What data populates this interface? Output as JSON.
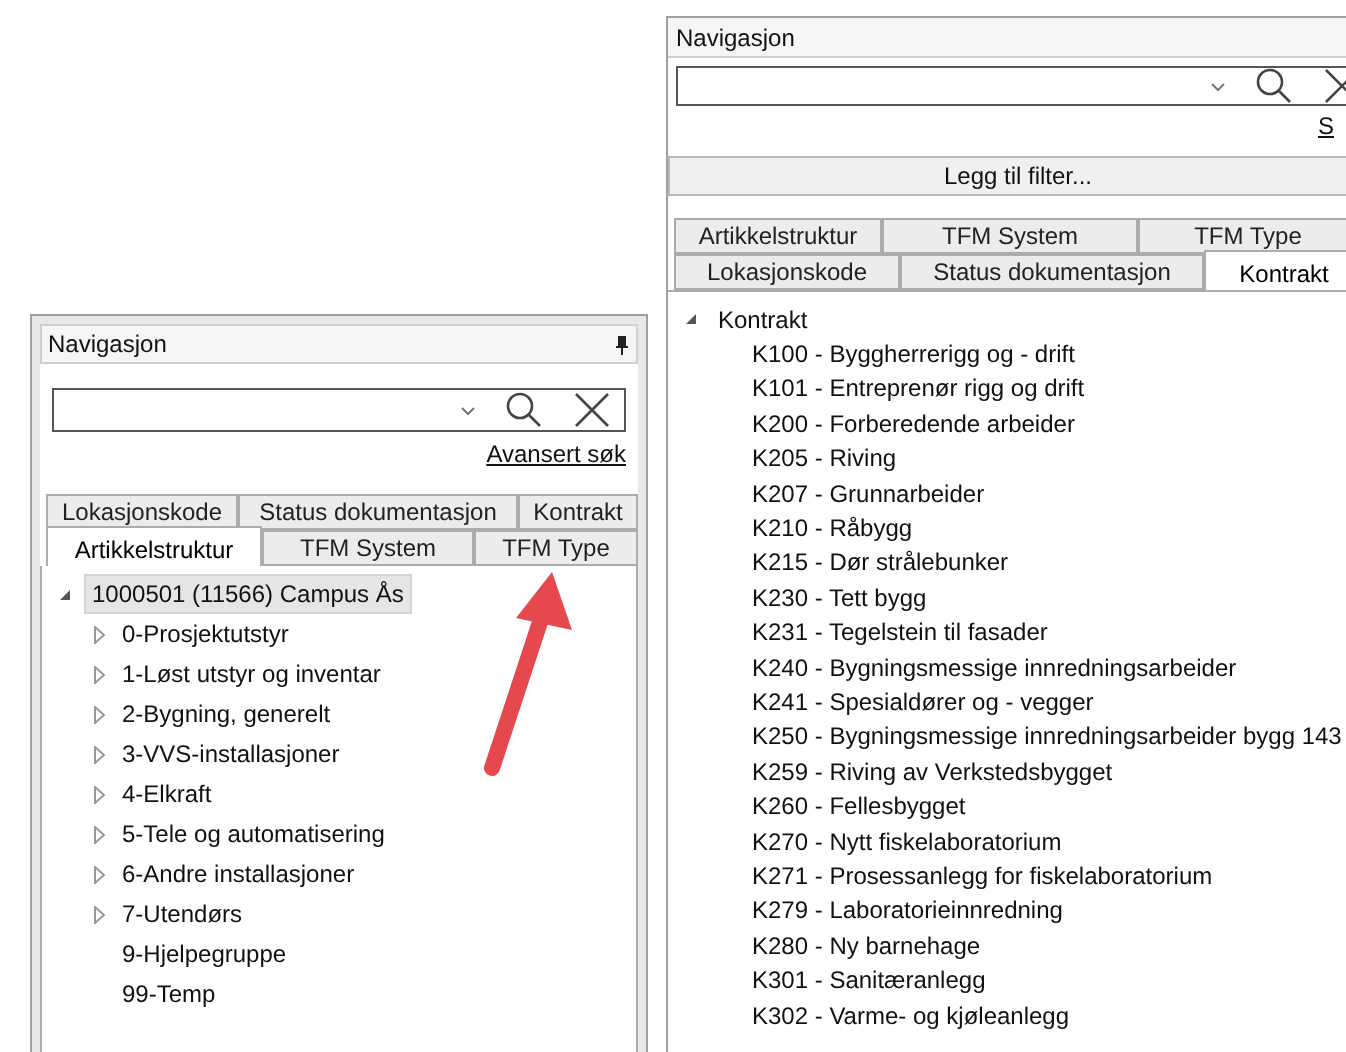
{
  "right_panel": {
    "title": "Navigasjon",
    "search_link": "S",
    "filter_button": "Legg til filter...",
    "tab_rows": [
      [
        {
          "label": "Artikkelstruktur",
          "selected": false
        },
        {
          "label": "TFM System",
          "selected": false
        },
        {
          "label": "TFM Type",
          "selected": false
        }
      ],
      [
        {
          "label": "Lokasjonskode",
          "selected": false
        },
        {
          "label": "Status dokumentasjon",
          "selected": false
        },
        {
          "label": "Kontrakt",
          "selected": true
        }
      ]
    ],
    "tree": {
      "label": "Kontrakt",
      "expanded": true,
      "selected": false,
      "children": [
        {
          "label": "K100 - Byggherrerigg og - drift",
          "has_children": false
        },
        {
          "label": "K101 - Entreprenør rigg og drift",
          "has_children": false
        },
        {
          "label": "K200 - Forberedende arbeider",
          "has_children": false
        },
        {
          "label": "K205 - Riving",
          "has_children": false
        },
        {
          "label": "K207 - Grunnarbeider",
          "has_children": false
        },
        {
          "label": "K210 - Råbygg",
          "has_children": false
        },
        {
          "label": "K215 - Dør strålebunker",
          "has_children": false
        },
        {
          "label": "K230 - Tett bygg",
          "has_children": false
        },
        {
          "label": "K231 - Tegelstein til fasader",
          "has_children": false
        },
        {
          "label": "K240 - Bygningsmessige innredningsarbeider",
          "has_children": false
        },
        {
          "label": "K241 - Spesialdører og - vegger",
          "has_children": false
        },
        {
          "label": "K250 - Bygningsmessige innredningsarbeider bygg 143",
          "has_children": false
        },
        {
          "label": "K259 - Riving av Verkstedsbygget",
          "has_children": false
        },
        {
          "label": "K260 - Fellesbygget",
          "has_children": false
        },
        {
          "label": "K270 - Nytt fiskelaboratorium",
          "has_children": false
        },
        {
          "label": "K271 - Prosessanlegg for fiskelaboratorium",
          "has_children": false
        },
        {
          "label": "K279 - Laboratorieinnredning",
          "has_children": false
        },
        {
          "label": "K280 - Ny barnehage",
          "has_children": false
        },
        {
          "label": "K301 - Sanitæranlegg",
          "has_children": false
        },
        {
          "label": "K302 - Varme- og kjøleanlegg",
          "has_children": false
        }
      ]
    }
  },
  "left_panel": {
    "title": "Navigasjon",
    "search_link": "Avansert søk",
    "tab_rows": [
      [
        {
          "label": "Lokasjonskode",
          "selected": false
        },
        {
          "label": "Status dokumentasjon",
          "selected": false
        },
        {
          "label": "Kontrakt",
          "selected": false
        }
      ],
      [
        {
          "label": "Artikkelstruktur",
          "selected": true
        },
        {
          "label": "TFM System",
          "selected": false
        },
        {
          "label": "TFM Type",
          "selected": false
        }
      ]
    ],
    "tree": {
      "label": "1000501 (11566) Campus Ås",
      "expanded": true,
      "selected": true,
      "children": [
        {
          "label": "0-Prosjektutstyr",
          "has_children": true
        },
        {
          "label": "1-Løst utstyr og inventar",
          "has_children": true
        },
        {
          "label": "2-Bygning, generelt",
          "has_children": true
        },
        {
          "label": "3-VVS-installasjoner",
          "has_children": true
        },
        {
          "label": "4-Elkraft",
          "has_children": true
        },
        {
          "label": "5-Tele og automatisering",
          "has_children": true
        },
        {
          "label": "6-Andre installasjoner",
          "has_children": true
        },
        {
          "label": "7-Utendørs",
          "has_children": true
        },
        {
          "label": "9-Hjelpegruppe",
          "has_children": false
        },
        {
          "label": "99-Temp",
          "has_children": false
        }
      ]
    }
  }
}
